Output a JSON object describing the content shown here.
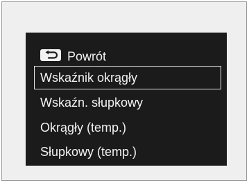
{
  "menu": {
    "back": {
      "icon": "back-arrow-icon",
      "label": "Powrót"
    },
    "items": [
      {
        "label": "Wskaźnik okrągły",
        "selected": true
      },
      {
        "label": "Wskaźn. słupkowy",
        "selected": false
      },
      {
        "label": "Okrągły (temp.)",
        "selected": false
      },
      {
        "label": "Słupkowy (temp.)",
        "selected": false
      }
    ]
  },
  "colors": {
    "background": "#efefef",
    "screen": "#1b1b1b",
    "text": "#f2f2f2",
    "selection_border": "#e8e8e8"
  }
}
